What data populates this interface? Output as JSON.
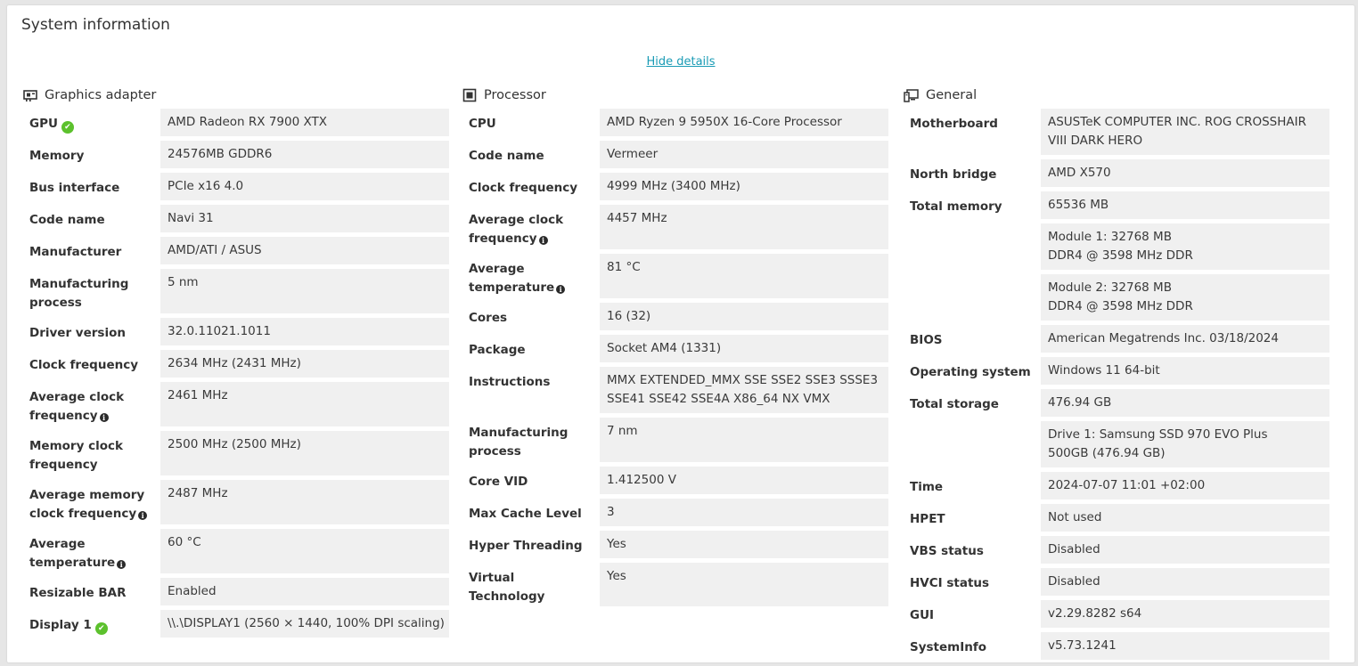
{
  "title": "System information",
  "toggle_label": "Hide details",
  "graphics": {
    "heading": "Graphics adapter",
    "icon": "graphics-card-icon",
    "rows": [
      {
        "key": "GPU",
        "value": "AMD Radeon RX 7900 XTX"
      },
      {
        "key": "Memory",
        "value": "24576MB GDDR6"
      },
      {
        "key": "Bus interface",
        "value": "PCIe x16 4.0"
      },
      {
        "key": "Code name",
        "value": "Navi 31"
      },
      {
        "key": "Manufacturer",
        "value": "AMD/ATI / ASUS"
      },
      {
        "key": "Manufacturing process",
        "value": "5 nm"
      },
      {
        "key": "Driver version",
        "value": "32.0.11021.1011"
      },
      {
        "key": "Clock frequency",
        "value": "2634 MHz (2431 MHz)"
      },
      {
        "key": "Average clock frequency",
        "value": "2461 MHz"
      },
      {
        "key": "Memory clock frequency",
        "value": "2500 MHz (2500 MHz)"
      },
      {
        "key": "Average memory clock frequency",
        "value": "2487 MHz"
      },
      {
        "key": "Average temperature",
        "value": "60 °C"
      },
      {
        "key": "Resizable BAR",
        "value": "Enabled"
      },
      {
        "key": "Display 1",
        "value": "\\\\.\\DISPLAY1 (2560 × 1440, 100% DPI scaling)"
      }
    ]
  },
  "processor": {
    "heading": "Processor",
    "icon": "cpu-chip-icon",
    "rows": [
      {
        "key": "CPU",
        "value": "AMD Ryzen 9 5950X 16-Core Processor"
      },
      {
        "key": "Code name",
        "value": "Vermeer"
      },
      {
        "key": "Clock frequency",
        "value": "4999 MHz (3400 MHz)"
      },
      {
        "key": "Average clock frequency",
        "value": "4457 MHz"
      },
      {
        "key": "Average temperature",
        "value": "81 °C"
      },
      {
        "key": "Cores",
        "value": "16 (32)"
      },
      {
        "key": "Package",
        "value": "Socket AM4 (1331)"
      },
      {
        "key": "Instructions",
        "value": "MMX EXTENDED_MMX SSE SSE2 SSE3 SSSE3 SSE41 SSE42 SSE4A X86_64 NX VMX"
      },
      {
        "key": "Manufacturing process",
        "value": "7 nm"
      },
      {
        "key": "Core VID",
        "value": "1.412500 V"
      },
      {
        "key": "Max Cache Level",
        "value": "3"
      },
      {
        "key": "Hyper Threading",
        "value": "Yes"
      },
      {
        "key": "Virtual Technology",
        "value": "Yes"
      }
    ]
  },
  "general": {
    "heading": "General",
    "icon": "computer-icon",
    "rows": [
      {
        "key": "Motherboard",
        "value": "ASUSTeK COMPUTER INC. ROG CROSSHAIR VIII DARK HERO"
      },
      {
        "key": "North bridge",
        "value": "AMD X570"
      },
      {
        "key": "Total memory",
        "value": "65536 MB"
      },
      {
        "key": "",
        "value": "Module 1: 32768 MB DDR4 @ 3598 MHz DDR"
      },
      {
        "key": "",
        "value": "Module 2: 32768 MB DDR4 @ 3598 MHz DDR"
      },
      {
        "key": "BIOS",
        "value": "American Megatrends Inc. 03/18/2024"
      },
      {
        "key": "Operating system",
        "value": "Windows 11 64-bit"
      },
      {
        "key": "Total storage",
        "value": "476.94 GB"
      },
      {
        "key": "",
        "value": "Drive 1: Samsung SSD 970 EVO Plus 500GB (476.94 GB)"
      },
      {
        "key": "Time",
        "value": "2024-07-07 11:01 +02:00"
      },
      {
        "key": "HPET",
        "value": "Not used"
      },
      {
        "key": "VBS status",
        "value": "Disabled"
      },
      {
        "key": "HVCI status",
        "value": "Disabled"
      },
      {
        "key": "GUI",
        "value": "v2.29.8282 s64"
      },
      {
        "key": "SystemInfo",
        "value": "v5.73.1241"
      }
    ]
  },
  "colors": {
    "link": "#1a9bb5",
    "value_bg": "#f0f0f0",
    "status_ok": "#5cc12d"
  }
}
